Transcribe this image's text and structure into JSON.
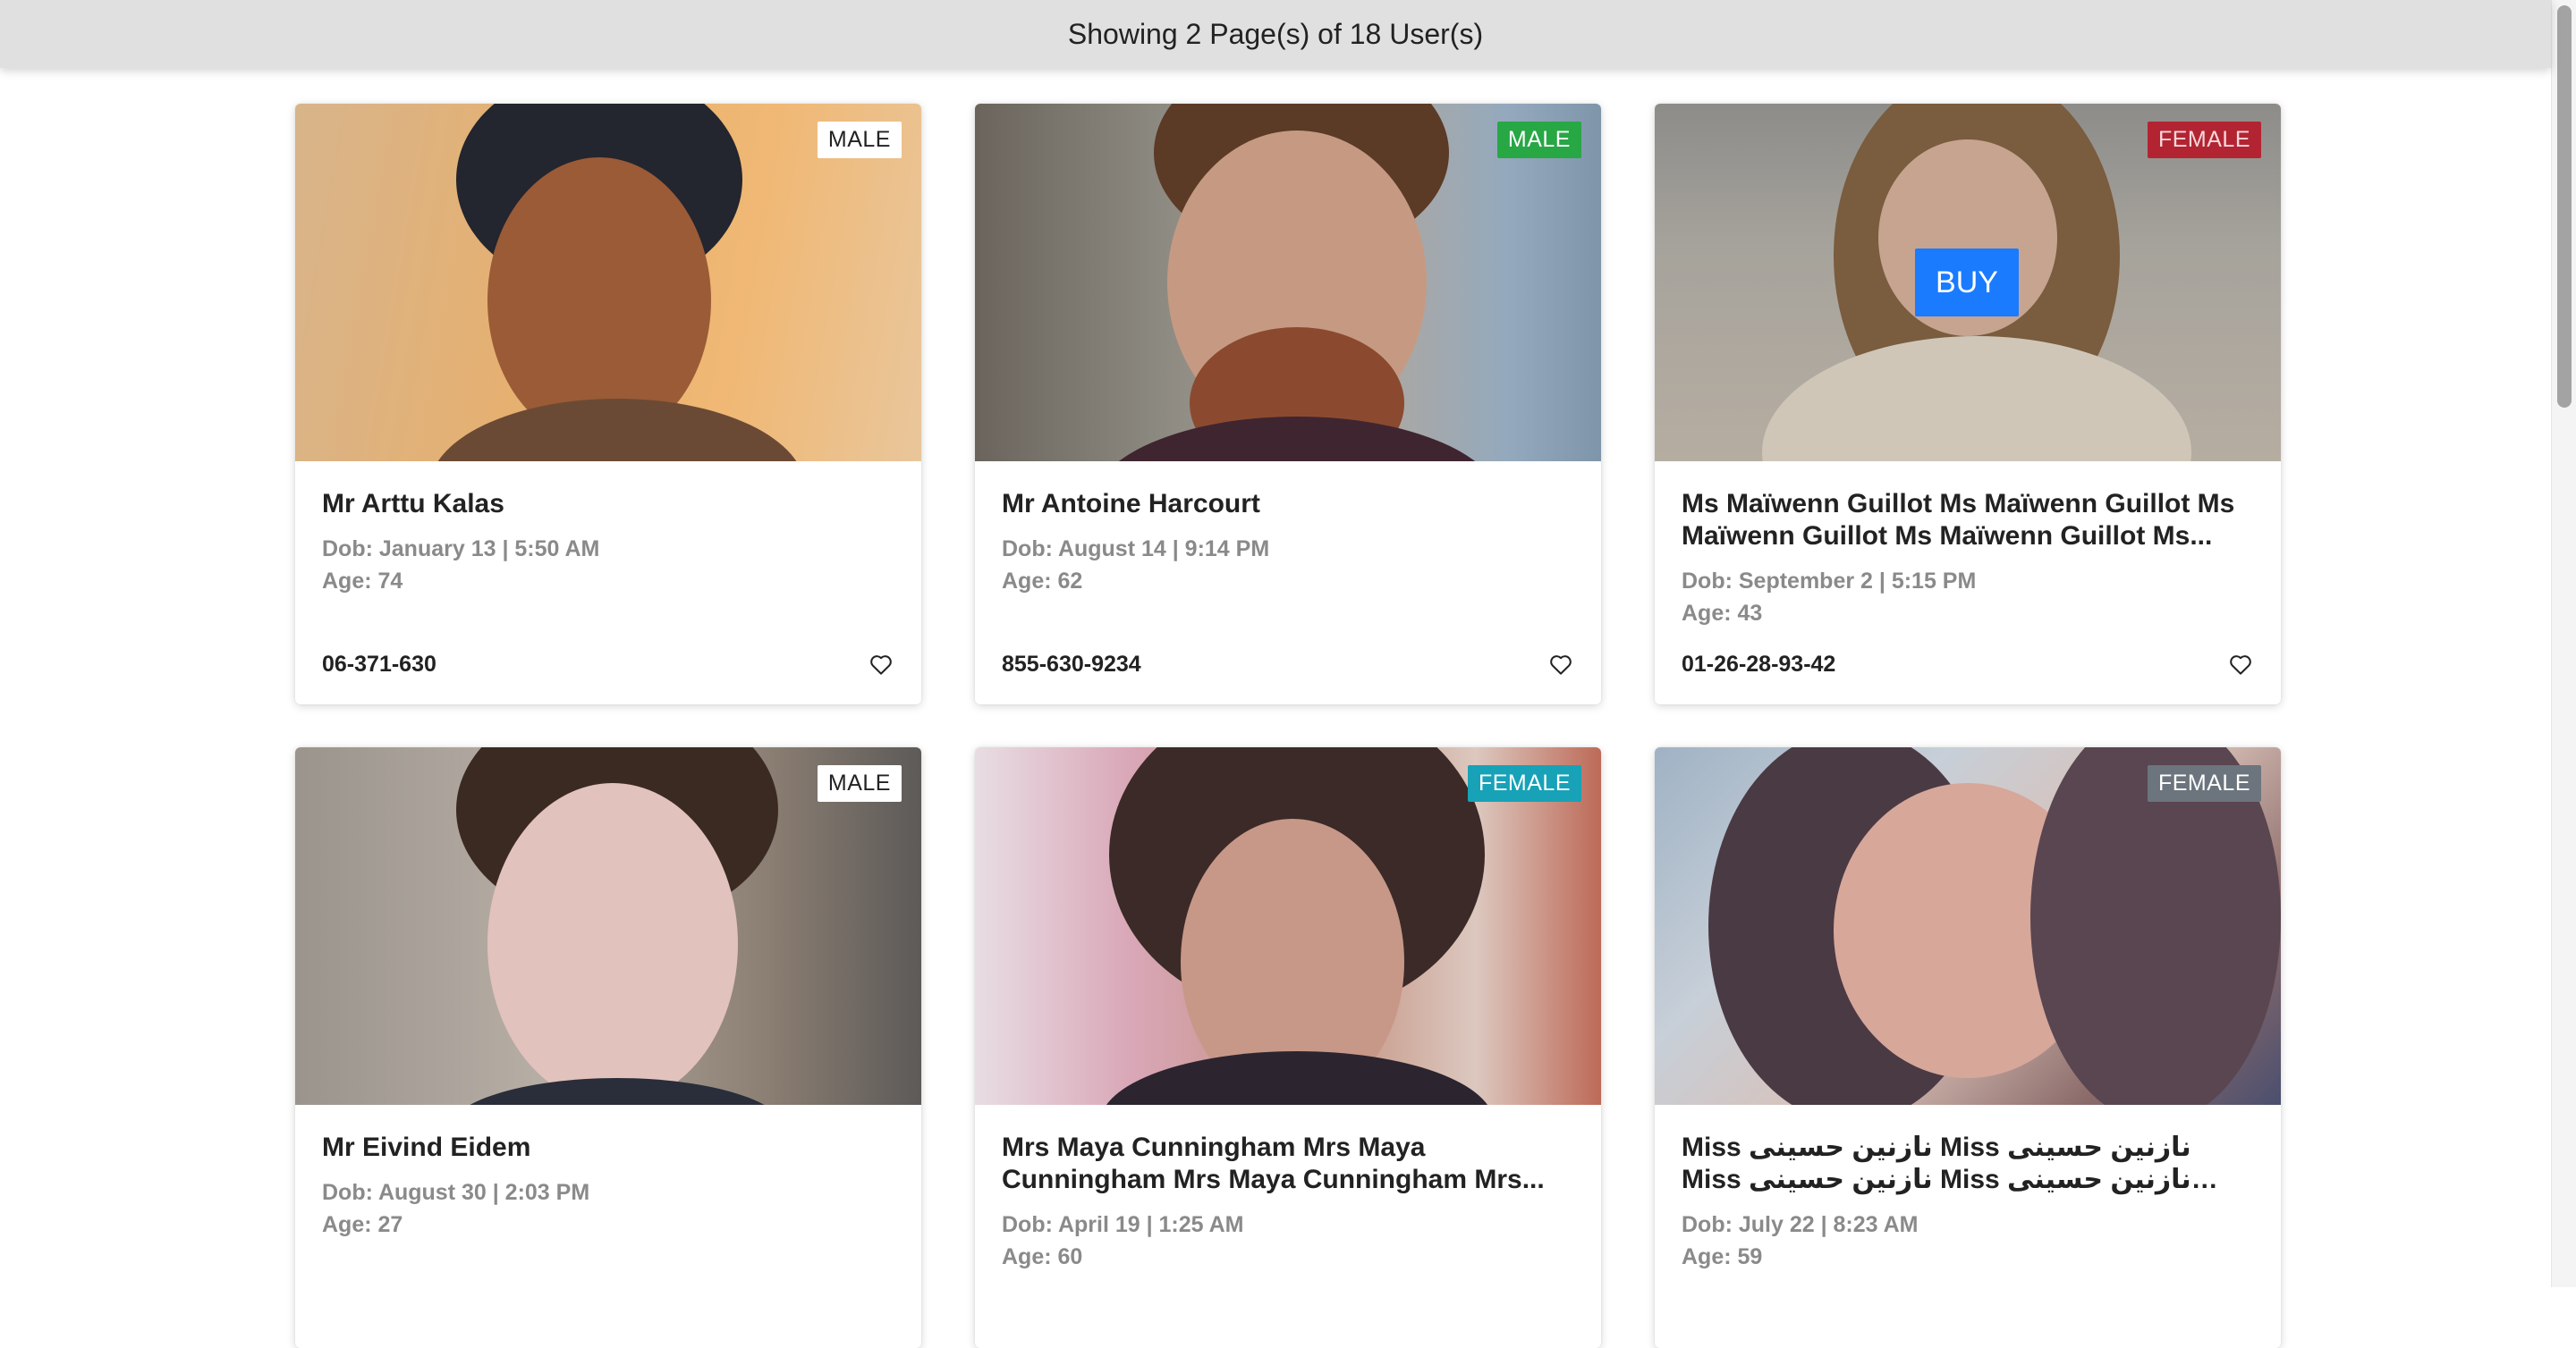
{
  "header": {
    "summary": "Showing 2 Page(s) of 18 User(s)"
  },
  "buy_label": "BUY",
  "colors": {
    "header_bg": "#e0e0e0",
    "buy_blue": "#1a7bff",
    "badge_green": "#28a745",
    "badge_red": "#b32432",
    "badge_teal": "#17a2b8",
    "badge_gray": "#6c757d"
  },
  "cards": [
    {
      "name": "Mr Arttu Kalas",
      "dob": "Dob: January 13 | 5:50 AM",
      "age": "Age: 74",
      "phone": "06-371-630",
      "gender": "MALE",
      "badge_style": "white",
      "favorite_icon": "heart-outline-icon"
    },
    {
      "name": "Mr Antoine Harcourt",
      "dob": "Dob: August 14 | 9:14 PM",
      "age": "Age: 62",
      "phone": "855-630-9234",
      "gender": "MALE",
      "badge_style": "green",
      "favorite_icon": "heart-outline-icon"
    },
    {
      "name": "Ms Maïwenn Guillot Ms Maïwenn Guillot Ms Maïwenn Guillot Ms Maïwenn Guillot Ms...",
      "dob": "Dob: September 2 | 5:15 PM",
      "age": "Age: 43",
      "phone": "01-26-28-93-42",
      "gender": "FEMALE",
      "badge_style": "red",
      "favorite_icon": "heart-outline-icon"
    },
    {
      "name": "Mr Eivind Eidem",
      "dob": "Dob: August 30 | 2:03 PM",
      "age": "Age: 27",
      "phone": "",
      "gender": "MALE",
      "badge_style": "white",
      "favorite_icon": "heart-outline-icon"
    },
    {
      "name": "Mrs Maya Cunningham Mrs Maya Cunningham Mrs Maya Cunningham Mrs...",
      "dob": "Dob: April 19 | 1:25 AM",
      "age": "Age: 60",
      "phone": "",
      "gender": "FEMALE",
      "badge_style": "teal",
      "favorite_icon": "heart-outline-icon"
    },
    {
      "name": "Miss نازنین حسینی Miss نازنین حسینی Miss نازنین حسینی Miss نازنین حسینی Miss...",
      "dob": "Dob: July 22 | 8:23 AM",
      "age": "Age: 59",
      "phone": "",
      "gender": "FEMALE",
      "badge_style": "gray",
      "favorite_icon": "heart-outline-icon"
    }
  ]
}
